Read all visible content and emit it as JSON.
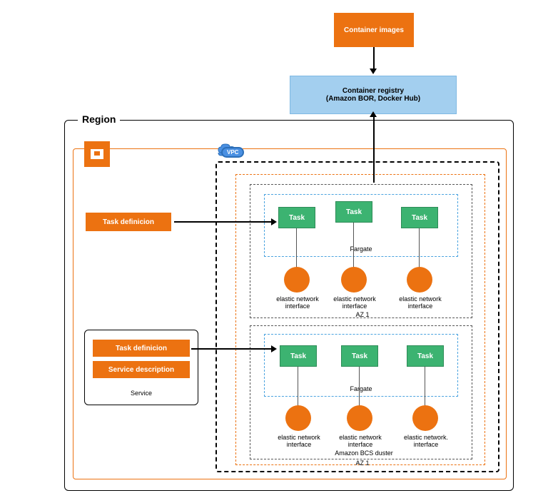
{
  "container_images": "Container images",
  "registry": {
    "title": "Container  registry",
    "subtitle": "(Amazon BOR, Docker Hub)"
  },
  "region": "Region",
  "vpc_badge": "VPC",
  "task_def_1": "Task definicion",
  "service": {
    "task_def": "Task definicion",
    "service_desc": "Service description",
    "label": "Service"
  },
  "az1": {
    "fargate": "Fargate",
    "tasks": [
      "Task",
      "Task",
      "Task"
    ],
    "eni": [
      "elastic network interface",
      "elastic network interface",
      "elastic network interface"
    ],
    "az_label": "AZ 1"
  },
  "az2": {
    "fargate": "Fargate",
    "tasks": [
      "Task",
      "Task",
      "Task"
    ],
    "eni": [
      "elastic network interface",
      "elastic network interface",
      "elastic network. interface"
    ],
    "cluster_label": "Amazon BCS duster",
    "az_label": "AZ 1"
  }
}
